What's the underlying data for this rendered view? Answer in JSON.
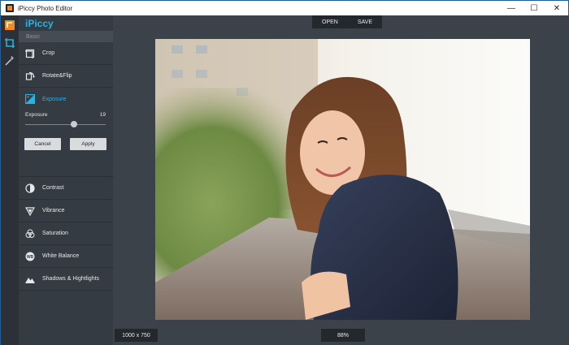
{
  "window": {
    "title": "iPiccy Photo Editor"
  },
  "panel": {
    "brand": "iPiccy",
    "section": "Basic",
    "items_top": [
      {
        "label": "Crop"
      },
      {
        "label": "Rotate&Flip"
      }
    ],
    "active": {
      "label": "Exposure"
    },
    "exposure": {
      "label": "Exposure",
      "value": "19",
      "level": 0.61
    },
    "cancel_label": "Cancel",
    "apply_label": "Apply",
    "items_bottom": [
      {
        "label": "Contrast"
      },
      {
        "label": "Vibrance"
      },
      {
        "label": "Saturation"
      },
      {
        "label": "White Balance"
      },
      {
        "label": "Shadows & Hightlights"
      }
    ]
  },
  "toolbar": {
    "open_label": "OPEN",
    "save_label": "SAVE"
  },
  "status": {
    "dimensions": "1000 x 750",
    "zoom": "88%"
  },
  "colors": {
    "accent": "#22b5e6",
    "brand_orange": "#f08b1c",
    "panel_bg": "#353b42",
    "workspace_bg": "#3b4249"
  }
}
